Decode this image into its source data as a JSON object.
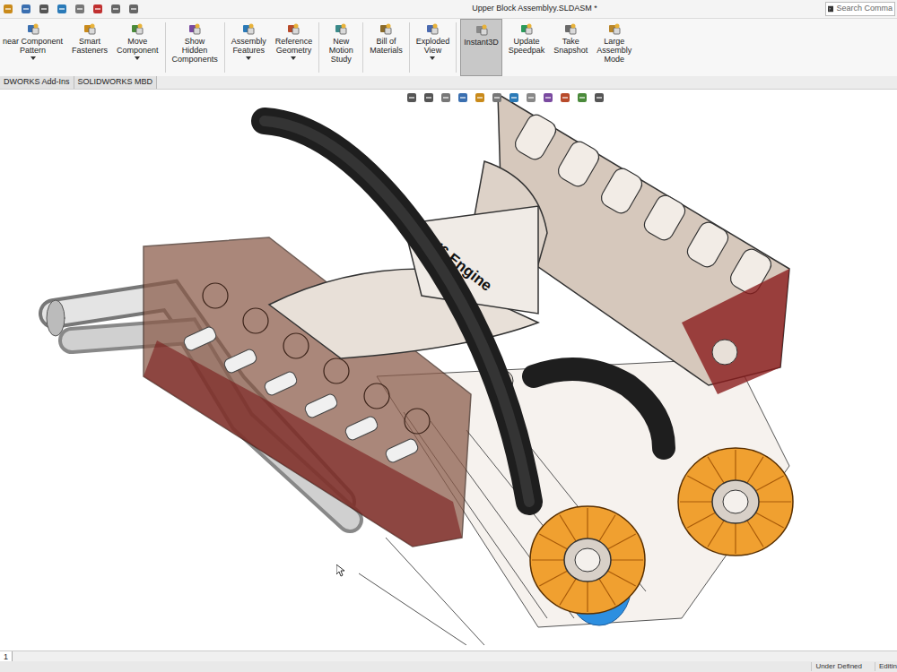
{
  "window": {
    "title": "Upper Block Assemblyy.SLDASM *"
  },
  "search": {
    "placeholder": "Search Comma"
  },
  "toolbar": [
    {
      "lines": [
        "near Component",
        "Pattern"
      ],
      "dropdown": true,
      "selected": false
    },
    {
      "lines": [
        "Smart",
        "Fasteners"
      ],
      "dropdown": false,
      "selected": false
    },
    {
      "lines": [
        "Move",
        "Component"
      ],
      "dropdown": true,
      "selected": false
    },
    {
      "lines": [
        "Show",
        "Hidden",
        "Components"
      ],
      "dropdown": false,
      "selected": false
    },
    {
      "lines": [
        "Assembly",
        "Features"
      ],
      "dropdown": true,
      "selected": false
    },
    {
      "lines": [
        "Reference",
        "Geometry"
      ],
      "dropdown": true,
      "selected": false
    },
    {
      "lines": [
        "New",
        "Motion",
        "Study"
      ],
      "dropdown": false,
      "selected": false
    },
    {
      "lines": [
        "Bill of",
        "Materials"
      ],
      "dropdown": false,
      "selected": false
    },
    {
      "lines": [
        "Exploded",
        "View"
      ],
      "dropdown": true,
      "selected": false
    },
    {
      "lines": [
        "Instant3D"
      ],
      "dropdown": false,
      "selected": true
    },
    {
      "lines": [
        "Update",
        "Speedpak"
      ],
      "dropdown": false,
      "selected": false
    },
    {
      "lines": [
        "Take",
        "Snapshot"
      ],
      "dropdown": false,
      "selected": false
    },
    {
      "lines": [
        "Large",
        "Assembly",
        "Mode"
      ],
      "dropdown": false,
      "selected": false
    }
  ],
  "tabs": [
    {
      "label": "DWORKS Add-Ins",
      "selected": false
    },
    {
      "label": "SOLIDWORKS MBD",
      "selected": false
    }
  ],
  "model": {
    "label": "V6 Engine"
  },
  "sheet_tabs": [
    {
      "label": "1",
      "selected": true
    }
  ],
  "status_bar": {
    "items": [
      "Under Defined",
      "Editin"
    ]
  }
}
